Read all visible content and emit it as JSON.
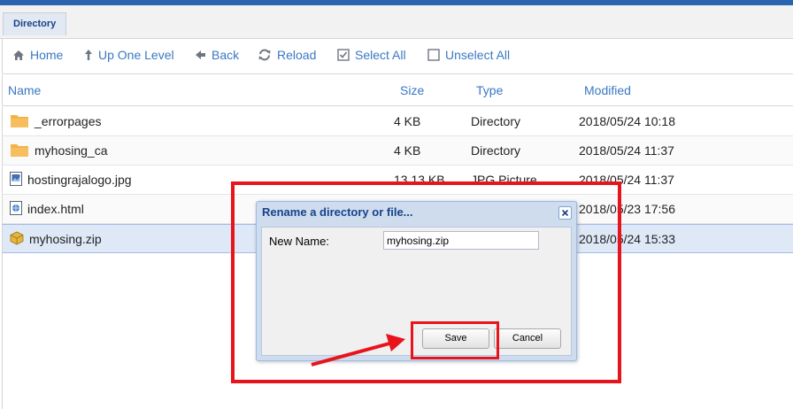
{
  "tab": {
    "label": "Directory"
  },
  "toolbar": {
    "home": "Home",
    "up": "Up One Level",
    "back": "Back",
    "reload": "Reload",
    "select_all": "Select All",
    "unselect_all": "Unselect All"
  },
  "columns": {
    "name": "Name",
    "size": "Size",
    "type": "Type",
    "modified": "Modified"
  },
  "files": [
    {
      "name": "_errorpages",
      "size": "4 KB",
      "type": "Directory",
      "modified": "2018/05/24 10:18",
      "icon": "folder-icon"
    },
    {
      "name": "myhosing_ca",
      "size": "4 KB",
      "type": "Directory",
      "modified": "2018/05/24 11:37",
      "icon": "folder-icon"
    },
    {
      "name": "hostingrajalogo.jpg",
      "size": "13.13 KB",
      "type": "JPG Picture",
      "modified": "2018/05/24 11:37",
      "icon": "image-file-icon"
    },
    {
      "name": "index.html",
      "size": "",
      "type": "",
      "modified": "2018/05/23 17:56",
      "icon": "html-file-icon"
    },
    {
      "name": "myhosing.zip",
      "size": "",
      "type": "",
      "modified": "2018/05/24 15:33",
      "icon": "zip-file-icon"
    }
  ],
  "dialog": {
    "title": "Rename a directory or file...",
    "label": "New Name:",
    "value": "myhosing.zip",
    "save": "Save",
    "cancel": "Cancel"
  },
  "colors": {
    "accent": "#3a78c3",
    "header_bar": "#2a64ae",
    "highlight": "#e8141b",
    "selected_row": "#dfe8f6"
  }
}
